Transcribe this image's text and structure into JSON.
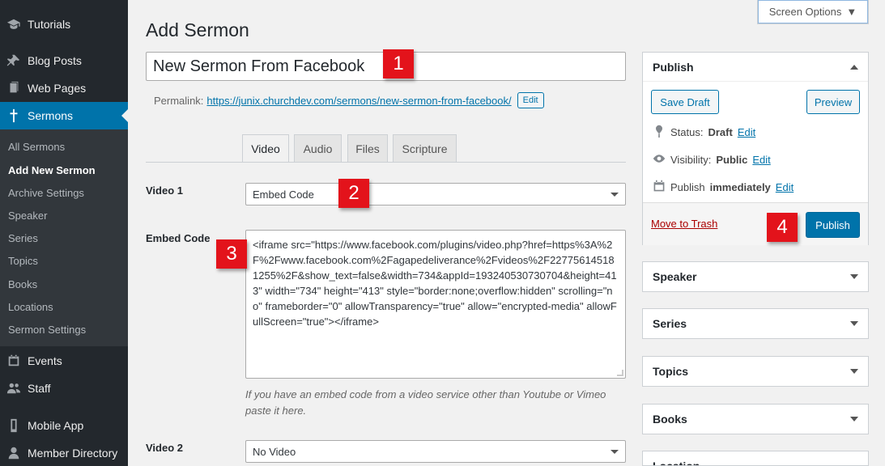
{
  "sidebar": {
    "top_items": [
      {
        "label": "Tutorials",
        "icon": "graduation-cap-icon"
      },
      {
        "label": "Blog Posts",
        "icon": "pin-icon"
      },
      {
        "label": "Web Pages",
        "icon": "pages-icon"
      },
      {
        "label": "Sermons",
        "icon": "cross-icon"
      }
    ],
    "sub_items": [
      "All Sermons",
      "Add New Sermon",
      "Archive Settings",
      "Speaker",
      "Series",
      "Topics",
      "Books",
      "Locations",
      "Sermon Settings"
    ],
    "bottom_items": [
      {
        "label": "Events",
        "icon": "calendar-icon"
      },
      {
        "label": "Staff",
        "icon": "people-icon"
      },
      {
        "label": "Mobile App",
        "icon": "phone-icon"
      },
      {
        "label": "Member Directory",
        "icon": "person-icon"
      }
    ]
  },
  "header": {
    "title": "Add Sermon",
    "screen_options": "Screen Options"
  },
  "editor": {
    "title_value": "New Sermon From Facebook",
    "permalink_label": "Permalink:",
    "permalink_url": "https://junix.churchdev.com/sermons/new-sermon-from-facebook/",
    "permalink_edit": "Edit"
  },
  "tabs": [
    "Video",
    "Audio",
    "Files",
    "Scripture"
  ],
  "fields": {
    "video1_label": "Video 1",
    "video1_value": "Embed Code",
    "embed_label": "Embed Code",
    "embed_value": "<iframe src=\"https://www.facebook.com/plugins/video.php?href=https%3A%2F%2Fwww.facebook.com%2Fagapedeliverance%2Fvideos%2F227756145181255%2F&show_text=false&width=734&appId=193240530730704&height=413\" width=\"734\" height=\"413\" style=\"border:none;overflow:hidden\" scrolling=\"no\" frameborder=\"0\" allowTransparency=\"true\" allow=\"encrypted-media\" allowFullScreen=\"true\"></iframe>",
    "embed_help": "If you have an embed code from a video service other than Youtube or Vimeo paste it here.",
    "video2_label": "Video 2",
    "video2_value": "No Video"
  },
  "publish": {
    "title": "Publish",
    "save_draft": "Save Draft",
    "preview": "Preview",
    "status_label": "Status:",
    "status_value": "Draft",
    "visibility_label": "Visibility:",
    "visibility_value": "Public",
    "publish_label": "Publish",
    "publish_value": "immediately",
    "edit": "Edit",
    "trash": "Move to Trash",
    "publish_button": "Publish"
  },
  "boxes": [
    "Speaker",
    "Series",
    "Topics",
    "Books",
    "Location"
  ],
  "markers": [
    "1",
    "2",
    "3",
    "4"
  ],
  "colors": {
    "accent": "#0073aa",
    "sidebar": "#23282d",
    "marker": "#e3131b"
  }
}
